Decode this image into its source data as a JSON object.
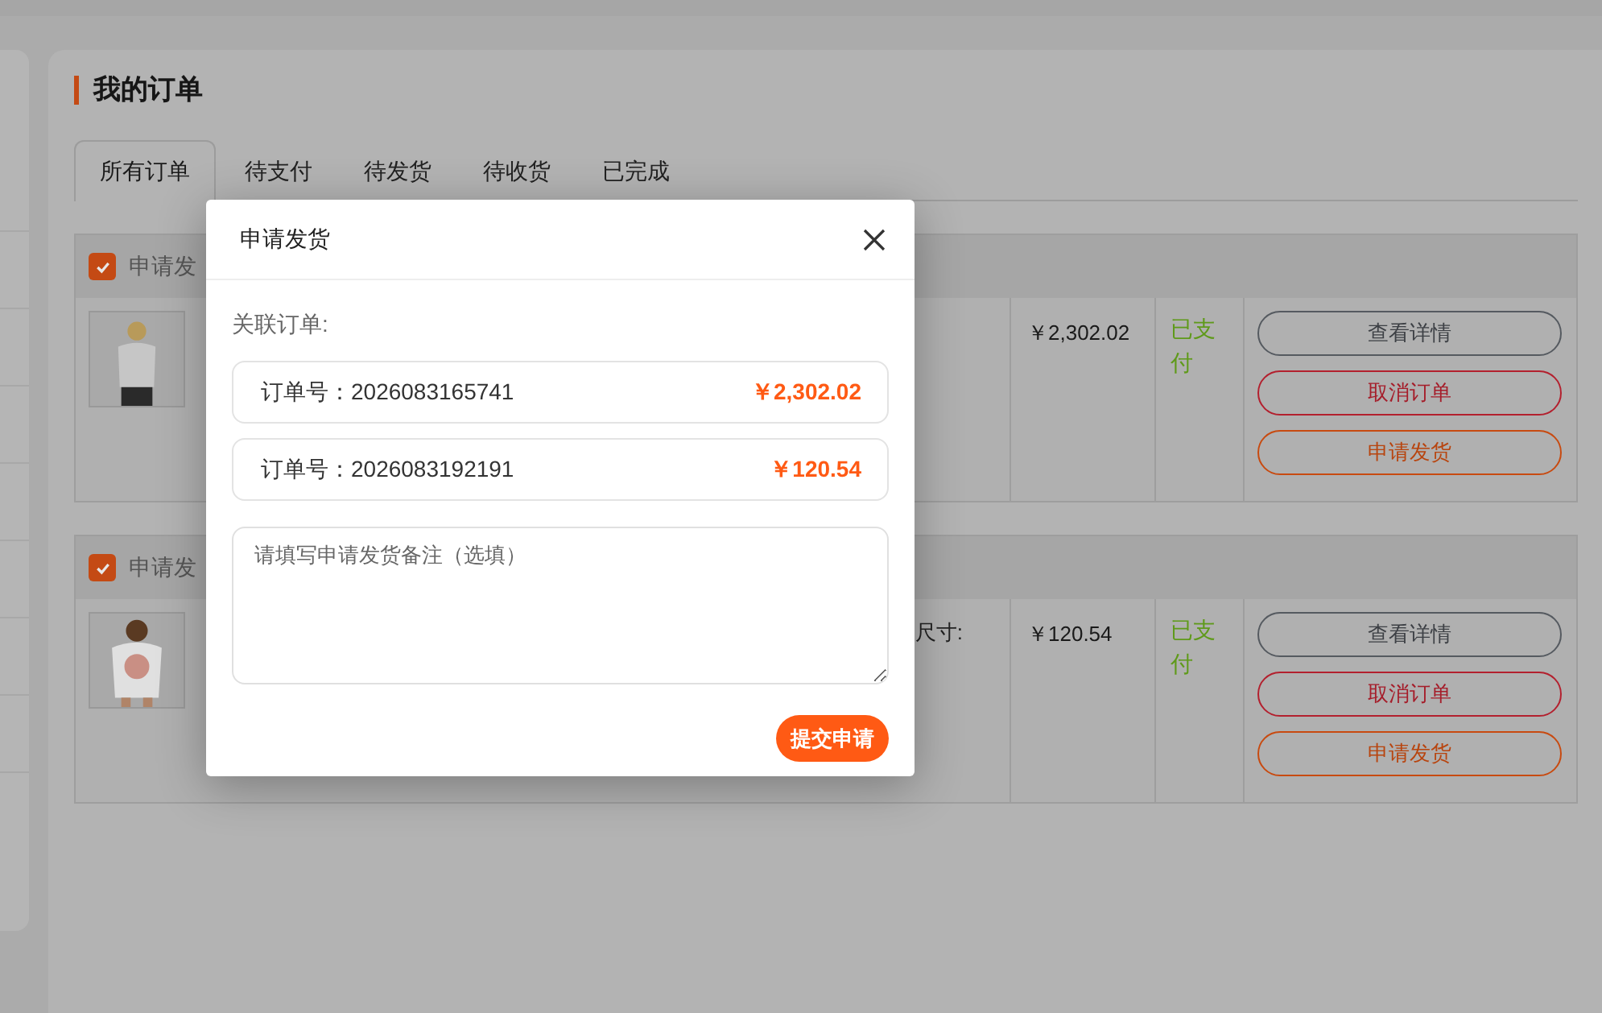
{
  "page": {
    "title": "我的订单"
  },
  "tabs": [
    {
      "label": "所有订单",
      "selected": true
    },
    {
      "label": "待支付",
      "selected": false
    },
    {
      "label": "待发货",
      "selected": false
    },
    {
      "label": "待收货",
      "selected": false
    },
    {
      "label": "已完成",
      "selected": false
    }
  ],
  "orders": [
    {
      "header_label": "申请发",
      "checked": true,
      "price": "￥2,302.02",
      "status": "已支付",
      "actions": [
        {
          "label": "查看详情",
          "kind": "neutral"
        },
        {
          "label": "取消订单",
          "kind": "danger"
        },
        {
          "label": "申请发货",
          "kind": "primary"
        }
      ]
    },
    {
      "header_label": "申请发",
      "checked": true,
      "spec": "尺寸:",
      "price": "￥120.54",
      "status": "已支付",
      "actions": [
        {
          "label": "查看详情",
          "kind": "neutral"
        },
        {
          "label": "取消订单",
          "kind": "danger"
        },
        {
          "label": "申请发货",
          "kind": "primary"
        }
      ]
    }
  ],
  "dialog": {
    "title": "申请发货",
    "section_label": "关联订单:",
    "orders": [
      {
        "label": "订单号：2026083165741",
        "amount": "￥2,302.02"
      },
      {
        "label": "订单号：2026083192191",
        "amount": "￥120.54"
      }
    ],
    "note": {
      "placeholder": "请填写申请发货备注（选填）"
    },
    "submit": "提交申请"
  }
}
